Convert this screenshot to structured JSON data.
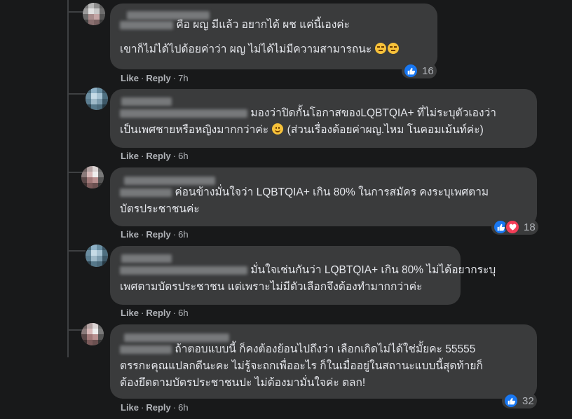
{
  "comments": [
    {
      "lines": [
        "คือ ผญ มีแล้ว อยากได้ ผช แค่นี้เองค่ะ",
        "เขาก็ไม่ได้ไปด้อยค่าว่า ผญ ไม่ได้ไม่มีความสามารถนะ"
      ],
      "like": "Like",
      "reply": "Reply",
      "time": "7h",
      "reaction_count": "16",
      "reactions": [
        "like"
      ]
    },
    {
      "lines": [
        "มองว่าปิดกั้นโอกาสของLQBTQIA+ ที่ไม่ระบุตัวเองว่า",
        "เป็นเพศชายหรือหญิงมากกว่าค่ะ",
        "(ส่วนเรื่องด้อยค่าผญ.ไหม โนคอมเม้นท์ค่ะ)"
      ],
      "like": "Like",
      "reply": "Reply",
      "time": "6h"
    },
    {
      "lines": [
        "ค่อนข้างมั่นใจว่า LQBTQIA+ เกิน 80% ในการสมัคร คงระบุเพศตาม",
        "บัตรประชาชนค่ะ"
      ],
      "like": "Like",
      "reply": "Reply",
      "time": "6h",
      "reaction_count": "18",
      "reactions": [
        "like",
        "love"
      ]
    },
    {
      "lines": [
        "มั่นใจเช่นกันว่า LQBTQIA+ เกิน 80% ไม่ได้อยากระบุ",
        "เพศตามบัตรประชาชน แต่เพราะไม่มีตัวเลือกจึงต้องทำมากกว่าค่ะ"
      ],
      "like": "Like",
      "reply": "Reply",
      "time": "6h"
    },
    {
      "lines": [
        "ถ้าตอบแบบนี้ ก็คงต้องย้อนไปถึงว่า เลือกเกิดไม่ได้ใช่มั้ยคะ 55555",
        "ตรรกะคุณแปลกดีนะคะ ไม่รู้จะถกเพื่ออะไร ก็ในเมื่ออยู่ในสถานะแบบนี้สุดท้ายก็",
        "ต้องยึดตามบัตรประชาชนปะ ไม่ต้องมามั่นใจค่ะ ตลก!"
      ],
      "like": "Like",
      "reply": "Reply",
      "time": "6h",
      "reaction_count": "32",
      "reactions": [
        "like"
      ]
    }
  ],
  "icons": {
    "like": "like-icon",
    "love": "love-icon"
  },
  "colors": {
    "background": "#18191a",
    "bubble": "#3a3b3c",
    "text": "#e4e6eb",
    "meta": "#b0b3b8",
    "like_blue": "#1877f2",
    "love_red": "#f33e58"
  }
}
